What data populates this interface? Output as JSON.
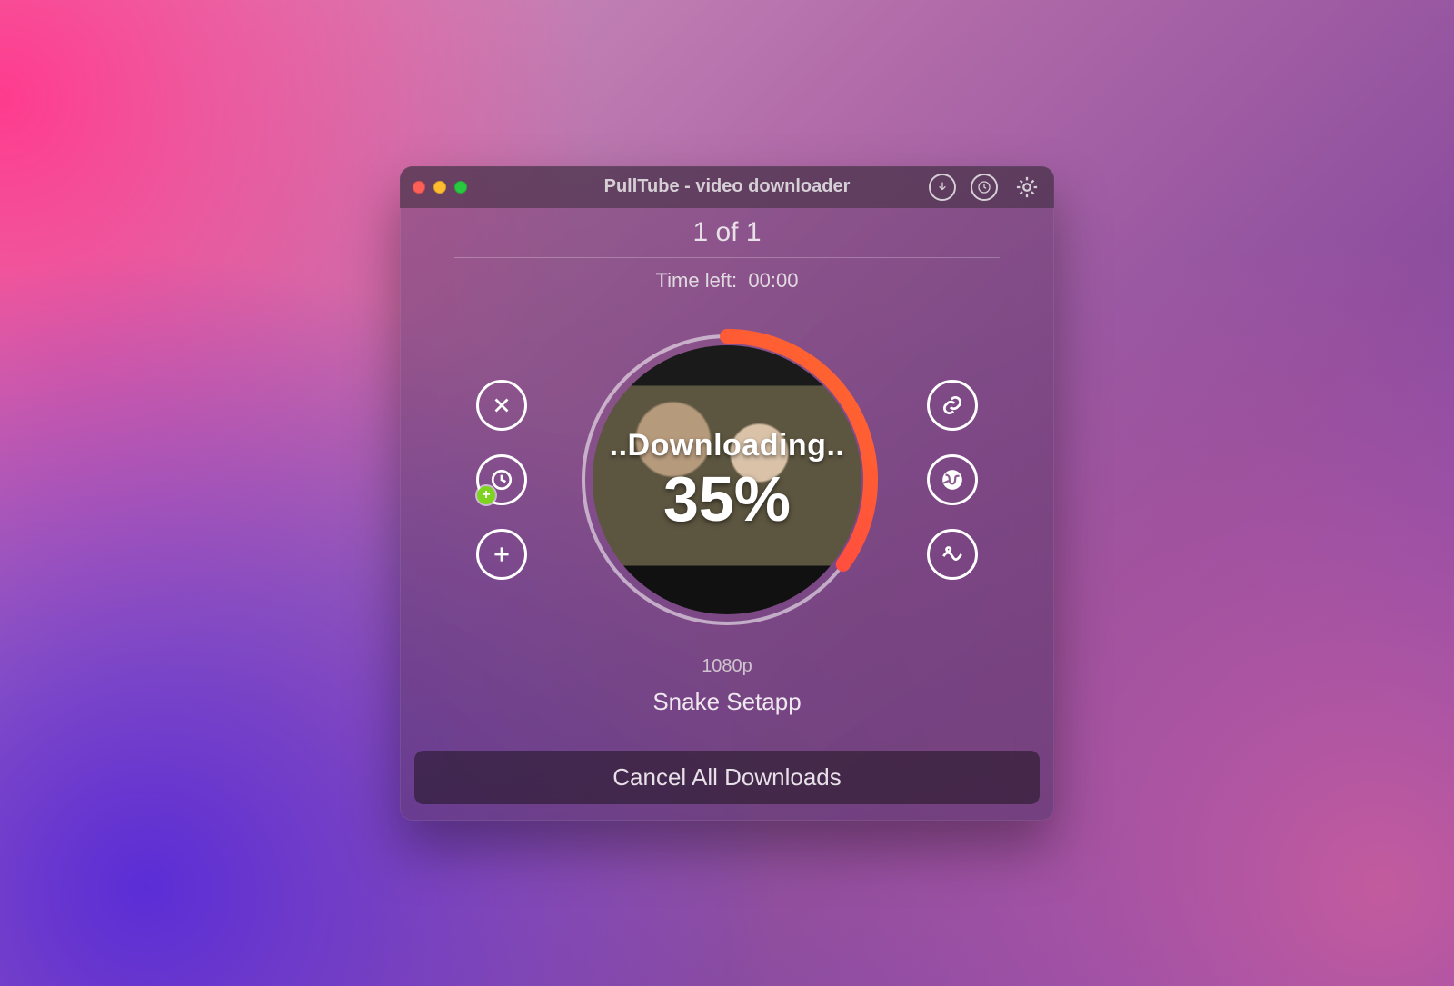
{
  "window": {
    "title": "PullTube - video downloader"
  },
  "header": {
    "counter": "1 of 1",
    "time_left_label": "Time left:",
    "time_left_value": "00:00"
  },
  "download": {
    "status_text": "..Downloading..",
    "progress_percent": 35,
    "progress_display": "35%",
    "quality": "1080p",
    "video_title": "Snake  Setapp"
  },
  "actions": {
    "left": {
      "cancel_icon": "close-icon",
      "schedule_icon": "clock-plus-icon",
      "add_icon": "plus-icon"
    },
    "right": {
      "link_icon": "link-icon",
      "globe_icon": "globe-icon",
      "image_icon": "image-icon"
    }
  },
  "footer": {
    "cancel_all_label": "Cancel All Downloads"
  },
  "colors": {
    "progress_start": "#ff2d55",
    "progress_end": "#ff6a2b",
    "accent_green": "#7ed321"
  }
}
